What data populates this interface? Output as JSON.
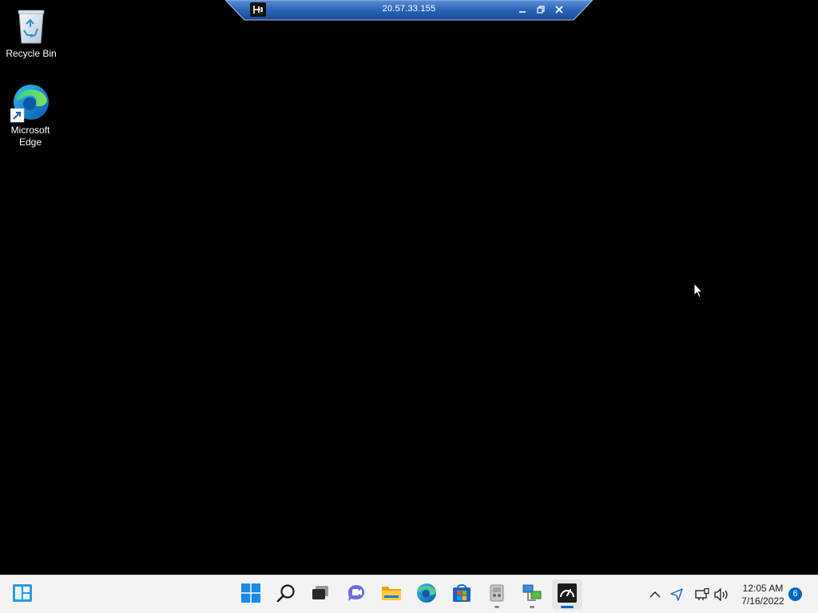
{
  "desktop": {
    "icons": [
      {
        "label": "Recycle Bin",
        "icon": "recycle-bin-icon"
      },
      {
        "label": "Microsoft Edge",
        "icon": "edge-icon"
      }
    ]
  },
  "remote_bar": {
    "title": "20.57.33.155",
    "color": "#2a64b8"
  },
  "taskbar": {
    "items": [
      {
        "name": "show-desktop",
        "icon": "widgets-icon"
      },
      {
        "name": "start",
        "icon": "windows-logo-icon"
      },
      {
        "name": "search",
        "icon": "search-icon"
      },
      {
        "name": "task-view",
        "icon": "task-view-icon"
      },
      {
        "name": "chat",
        "icon": "teams-chat-icon"
      },
      {
        "name": "file-explorer",
        "icon": "folder-icon"
      },
      {
        "name": "edge",
        "icon": "edge-icon"
      },
      {
        "name": "store",
        "icon": "store-icon"
      },
      {
        "name": "app-1",
        "icon": "utility-icon"
      },
      {
        "name": "app-2",
        "icon": "network-icon"
      },
      {
        "name": "app-3",
        "icon": "speedometer-icon"
      }
    ],
    "tray": {
      "time": "12:05 AM",
      "date": "7/16/2022",
      "notifications": "6",
      "icons": [
        "chevron-up-icon",
        "location-icon",
        "network-icon",
        "volume-icon"
      ]
    },
    "accent": "#0067c0"
  }
}
